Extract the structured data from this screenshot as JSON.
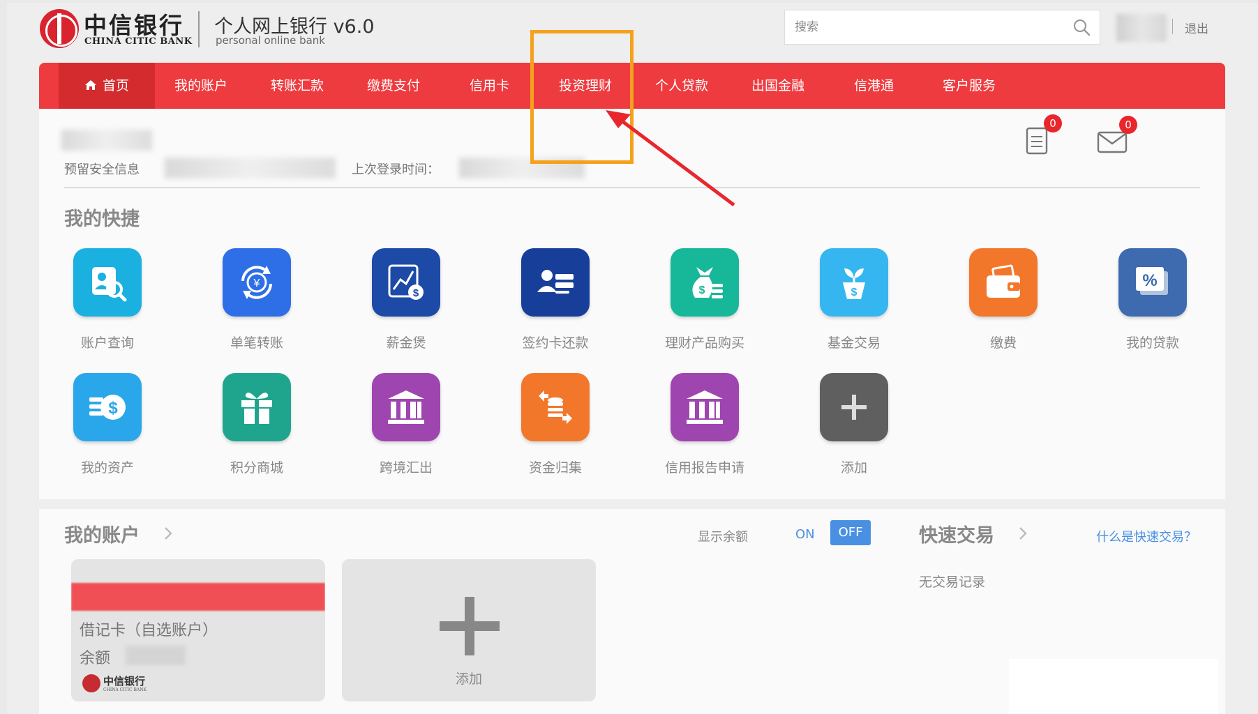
{
  "header": {
    "logo_cn": "中信银行",
    "logo_en": "CHINA CITIC BANK",
    "app_title": "个人网上银行 v6.0",
    "app_subtitle": "personal online bank",
    "search_placeholder": "搜索",
    "logout": "退出"
  },
  "nav": {
    "items": [
      "首页",
      "我的账户",
      "转账汇款",
      "缴费支付",
      "信用卡",
      "投资理财",
      "个人贷款",
      "出国金融",
      "信港通",
      "客户服务"
    ],
    "accent_color": "#ee3b3f",
    "active_color": "#d42b2f"
  },
  "info": {
    "safe_info_label": "预留安全信息",
    "last_login_label": "上次登录时间：",
    "doc_badge": "0",
    "mail_badge": "0"
  },
  "shortcuts": {
    "title": "我的快捷",
    "items": [
      {
        "label": "账户查询",
        "icon": "account-search-icon",
        "color": "#1ab0e0"
      },
      {
        "label": "单笔转账",
        "icon": "transfer-icon",
        "color": "#2e6ee6"
      },
      {
        "label": "薪金煲",
        "icon": "salary-chart-icon",
        "color": "#1c4aa6"
      },
      {
        "label": "签约卡还款",
        "icon": "card-repay-icon",
        "color": "#173f9a"
      },
      {
        "label": "理财产品购买",
        "icon": "money-bag-icon",
        "color": "#17b89a"
      },
      {
        "label": "基金交易",
        "icon": "fund-plant-icon",
        "color": "#35b6f0"
      },
      {
        "label": "缴费",
        "icon": "wallet-icon",
        "color": "#f3772a"
      },
      {
        "label": "我的贷款",
        "icon": "loan-percent-icon",
        "color": "#3e6aaf"
      },
      {
        "label": "我的资产",
        "icon": "assets-icon",
        "color": "#2aa7ea"
      },
      {
        "label": "积分商城",
        "icon": "gift-icon",
        "color": "#1fa58d"
      },
      {
        "label": "跨境汇出",
        "icon": "bank-building-icon",
        "color": "#9f45b0"
      },
      {
        "label": "资金归集",
        "icon": "coins-collect-icon",
        "color": "#f3772a"
      },
      {
        "label": "信用报告申请",
        "icon": "bank-building-icon",
        "color": "#9f45b0"
      },
      {
        "label": "添加",
        "icon": "plus-icon",
        "color": "#5f5f5f"
      }
    ]
  },
  "accounts": {
    "title": "我的账户",
    "show_balance_label": "显示余额",
    "toggle_on": "ON",
    "toggle_off": "OFF",
    "card_type": "借记卡（自选账户）",
    "balance_label": "余额",
    "card_bank_cn": "中信银行",
    "card_bank_en": "CHINA CITIC BANK",
    "add_label": "添加"
  },
  "quick_trade": {
    "title": "快速交易",
    "help_link": "什么是快速交易？",
    "empty_text": "无交易记录"
  }
}
